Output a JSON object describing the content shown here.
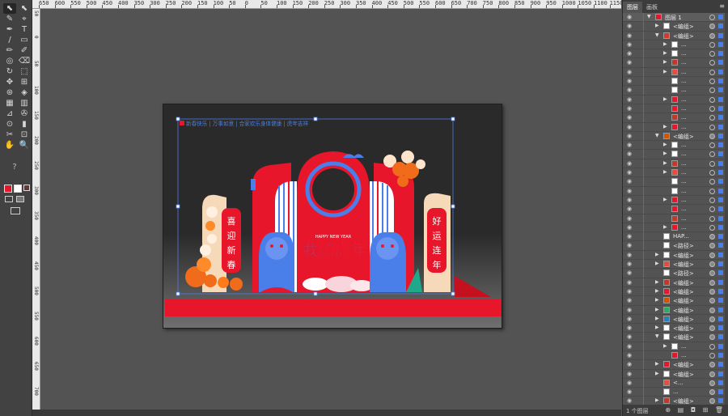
{
  "ruler_top_labels": [
    "650",
    "600",
    "550",
    "500",
    "450",
    "400",
    "350",
    "300",
    "250",
    "200",
    "150",
    "100",
    "50",
    "0",
    "50",
    "100",
    "150",
    "200",
    "250",
    "300",
    "350",
    "400",
    "450",
    "500",
    "550",
    "600",
    "650",
    "700",
    "750",
    "800",
    "850",
    "900",
    "950",
    "1000",
    "1050",
    "1100",
    "1150",
    "1200"
  ],
  "ruler_left_labels": [
    "50",
    "0",
    "50",
    "100",
    "150",
    "200",
    "250",
    "300",
    "350",
    "400",
    "450",
    "500",
    "550",
    "600",
    "650",
    "700"
  ],
  "design": {
    "headline_left": "喜迎新春",
    "headline_right": "好运连年",
    "center_title": "我的虎年",
    "happy_new_year": "HAPPY NEW YEAR",
    "top_text": "新春快乐 | 万事如意 | 合家欢乐身体健康 | 虎年吉祥"
  },
  "panel": {
    "tab_layers": "图层",
    "tab_other": "画板",
    "menu_icon": "≡",
    "layer_count": "1 个图层",
    "footer_icons": "⊕ ▤ ◘ ⊞ 🗑"
  },
  "layers": [
    {
      "label": "图层 1",
      "arrow": "▼",
      "indent": 0,
      "thumb": "#e8162a",
      "sel": true,
      "tc": "",
      "top": true
    },
    {
      "label": "<编组>",
      "arrow": "▶",
      "indent": 1,
      "thumb": "#ffffff",
      "sel": true,
      "tc": "filled"
    },
    {
      "label": "<编组>",
      "arrow": "▼",
      "indent": 1,
      "thumb": "#d43a2a",
      "sel": true,
      "tc": "filled"
    },
    {
      "label": "...",
      "arrow": "▶",
      "indent": 2,
      "thumb": "#ffffff",
      "sel": true,
      "tc": ""
    },
    {
      "label": "...",
      "arrow": "▶",
      "indent": 2,
      "thumb": "#ffffff",
      "sel": true,
      "tc": ""
    },
    {
      "label": "...",
      "arrow": "▶",
      "indent": 2,
      "thumb": "#c0392b",
      "sel": true,
      "tc": ""
    },
    {
      "label": "...",
      "arrow": "▶",
      "indent": 2,
      "thumb": "#e74c3c",
      "sel": true,
      "tc": ""
    },
    {
      "label": "...",
      "arrow": "",
      "indent": 2,
      "thumb": "#ffffff",
      "sel": true,
      "tc": ""
    },
    {
      "label": "...",
      "arrow": "",
      "indent": 2,
      "thumb": "#ffffff",
      "sel": true,
      "tc": ""
    },
    {
      "label": "...",
      "arrow": "▶",
      "indent": 2,
      "thumb": "#e8162a",
      "sel": true,
      "tc": ""
    },
    {
      "label": "...",
      "arrow": "",
      "indent": 2,
      "thumb": "#e8162a",
      "sel": true,
      "tc": ""
    },
    {
      "label": "...",
      "arrow": "",
      "indent": 2,
      "thumb": "#c0392b",
      "sel": true,
      "tc": ""
    },
    {
      "label": "...",
      "arrow": "▶",
      "indent": 2,
      "thumb": "#e8162a",
      "sel": true,
      "tc": ""
    },
    {
      "label": "<编组>",
      "arrow": "▼",
      "indent": 1,
      "thumb": "#d35400",
      "sel": true,
      "tc": "filled"
    },
    {
      "label": "...",
      "arrow": "▶",
      "indent": 2,
      "thumb": "#ffffff",
      "sel": true,
      "tc": ""
    },
    {
      "label": "...",
      "arrow": "▶",
      "indent": 2,
      "thumb": "#ffffff",
      "sel": true,
      "tc": ""
    },
    {
      "label": "...",
      "arrow": "▶",
      "indent": 2,
      "thumb": "#c0392b",
      "sel": true,
      "tc": ""
    },
    {
      "label": "...",
      "arrow": "▶",
      "indent": 2,
      "thumb": "#e74c3c",
      "sel": true,
      "tc": ""
    },
    {
      "label": "...",
      "arrow": "",
      "indent": 2,
      "thumb": "#ffffff",
      "sel": true,
      "tc": ""
    },
    {
      "label": "...",
      "arrow": "",
      "indent": 2,
      "thumb": "#ffffff",
      "sel": true,
      "tc": ""
    },
    {
      "label": "...",
      "arrow": "▶",
      "indent": 2,
      "thumb": "#e8162a",
      "sel": true,
      "tc": ""
    },
    {
      "label": "...",
      "arrow": "",
      "indent": 2,
      "thumb": "#e8162a",
      "sel": true,
      "tc": ""
    },
    {
      "label": "...",
      "arrow": "",
      "indent": 2,
      "thumb": "#c0392b",
      "sel": true,
      "tc": ""
    },
    {
      "label": "...",
      "arrow": "▶",
      "indent": 2,
      "thumb": "#e8162a",
      "sel": true,
      "tc": ""
    },
    {
      "label": "HAP...",
      "arrow": "",
      "indent": 1,
      "thumb": "#ffffff",
      "sel": true,
      "tc": "filled"
    },
    {
      "label": "<路径>",
      "arrow": "",
      "indent": 1,
      "thumb": "#ffffff",
      "sel": true,
      "tc": "filled"
    },
    {
      "label": "<编组>",
      "arrow": "▶",
      "indent": 1,
      "thumb": "#ffffff",
      "sel": true,
      "tc": "filled"
    },
    {
      "label": "<编组>",
      "arrow": "▶",
      "indent": 1,
      "thumb": "#e74c3c",
      "sel": true,
      "tc": "filled"
    },
    {
      "label": "<路径>",
      "arrow": "",
      "indent": 1,
      "thumb": "#ffffff",
      "sel": true,
      "tc": "filled"
    },
    {
      "label": "<编组>",
      "arrow": "▶",
      "indent": 1,
      "thumb": "#c0392b",
      "sel": true,
      "tc": "filled"
    },
    {
      "label": "<编组>",
      "arrow": "▶",
      "indent": 1,
      "thumb": "#e8162a",
      "sel": true,
      "tc": "filled"
    },
    {
      "label": "<编组>",
      "arrow": "▶",
      "indent": 1,
      "thumb": "#d35400",
      "sel": true,
      "tc": "filled"
    },
    {
      "label": "<编组>",
      "arrow": "▶",
      "indent": 1,
      "thumb": "#27ae60",
      "sel": true,
      "tc": "filled"
    },
    {
      "label": "<编组>",
      "arrow": "▶",
      "indent": 1,
      "thumb": "#2980b9",
      "sel": true,
      "tc": "filled"
    },
    {
      "label": "<编组>",
      "arrow": "▶",
      "indent": 1,
      "thumb": "#ffffff",
      "sel": true,
      "tc": "filled"
    },
    {
      "label": "<编组>",
      "arrow": "▼",
      "indent": 1,
      "thumb": "#ffffff",
      "sel": true,
      "tc": "filled"
    },
    {
      "label": "...",
      "arrow": "▶",
      "indent": 2,
      "thumb": "#ffffff",
      "sel": true,
      "tc": ""
    },
    {
      "label": "...",
      "arrow": "",
      "indent": 2,
      "thumb": "#e8162a",
      "sel": true,
      "tc": ""
    },
    {
      "label": "<编组>",
      "arrow": "▶",
      "indent": 1,
      "thumb": "#e8162a",
      "sel": true,
      "tc": "filled"
    },
    {
      "label": "<编组>",
      "arrow": "▶",
      "indent": 1,
      "thumb": "#ffffff",
      "sel": true,
      "tc": "filled"
    },
    {
      "label": "<...",
      "arrow": "",
      "indent": 1,
      "thumb": "#e74c3c",
      "sel": true,
      "tc": "filled"
    },
    {
      "label": "...",
      "arrow": "",
      "indent": 1,
      "thumb": "#ffffff",
      "sel": true,
      "tc": "filled"
    },
    {
      "label": "<编组>",
      "arrow": "▶",
      "indent": 1,
      "thumb": "#c0392b",
      "sel": true,
      "tc": "filled"
    },
    {
      "label": "<路径>",
      "arrow": "",
      "indent": 1,
      "thumb": "#ffffff",
      "sel": true,
      "tc": "filled"
    }
  ],
  "tools": [
    "⬉",
    "⬉",
    "✎",
    "⌖",
    "✒",
    "T",
    "/",
    "▭",
    "✏",
    "✐",
    "◎",
    "⌫",
    "↻",
    "⬚",
    "✥",
    "⊞",
    "⊛",
    "◈",
    "▦",
    "▥",
    "⊿",
    "✇",
    "⊙",
    "▮",
    "✂",
    "⊡",
    "✋",
    "🔍"
  ],
  "colors": {
    "accent_red": "#e8162a",
    "selection_blue": "#4a7ee8"
  }
}
